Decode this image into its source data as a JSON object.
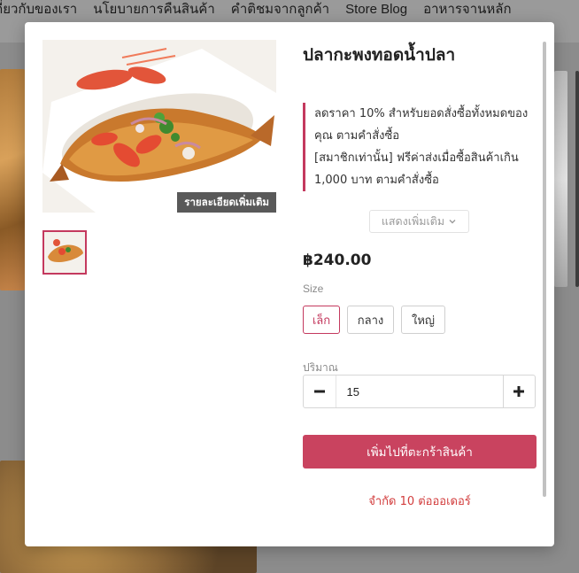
{
  "nav": {
    "items": [
      "เกี่ยวกับของเรา",
      "นโยบายการคืนสินค้า",
      "คำติชมจากลูกค้า",
      "Store Blog",
      "อาหารจานหลัก"
    ]
  },
  "product": {
    "title": "ปลากะพงทอดน้ำปลา",
    "more_details_label": "รายละเอียดเพิ่มเติม",
    "promo_lines": [
      "ลดราคา 10% สำหรับยอดสั่งซื้อทั้งหมดของ",
      "คุณ ตามคำสั่งซื้อ",
      "[สมาชิกเท่านั้น] ฟรีค่าส่งเมื่อซื้อสินค้าเกิน",
      "1,000 บาท ตามคำสั่งซื้อ"
    ],
    "show_more_label": "แสดงเพิ่มเติม",
    "price": "฿240.00",
    "size_label": "Size",
    "sizes": [
      "เล็ก",
      "กลาง",
      "ใหญ่"
    ],
    "selected_size": "เล็ก",
    "quantity_label": "ปริมาณ",
    "quantity_value": "15",
    "add_to_cart_label": "เพิ่มไปที่ตะกร้าสินค้า",
    "limit_text": "จำกัด 10 ต่อออเดอร์"
  },
  "icons": {
    "show_more": "chevron-down-icon",
    "decrease": "minus-icon",
    "increase": "plus-icon"
  },
  "colors": {
    "accent": "#c4395e",
    "cart_button": "#c9435f",
    "limit_text": "#d23c3c"
  }
}
